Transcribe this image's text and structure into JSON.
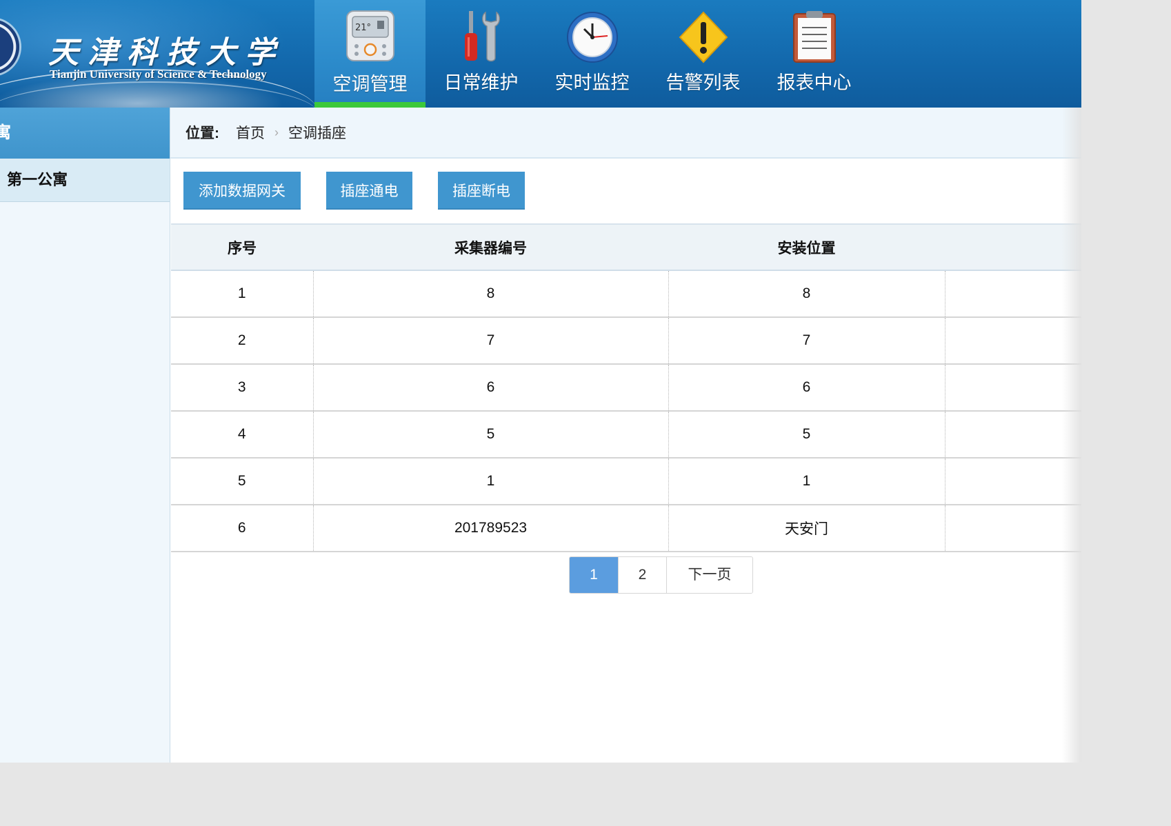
{
  "brand": {
    "name_cn": "天津科技大学",
    "name_en": "Tianjin University of Science & Technology"
  },
  "nav": {
    "items": [
      {
        "label": "空调管理",
        "icon": "air-conditioner-panel-icon",
        "active": true
      },
      {
        "label": "日常维护",
        "icon": "screwdriver-wrench-icon",
        "active": false
      },
      {
        "label": "实时监控",
        "icon": "clock-icon",
        "active": false
      },
      {
        "label": "告警列表",
        "icon": "warning-icon",
        "active": false
      },
      {
        "label": "报表中心",
        "icon": "clipboard-report-icon",
        "active": false
      }
    ],
    "active_indicator_color": "#3cc83a"
  },
  "sidebar": {
    "title": "寓",
    "items": [
      {
        "label": "第一公寓"
      }
    ]
  },
  "breadcrumb": {
    "label": "位置:",
    "items": [
      "首页",
      "空调插座"
    ]
  },
  "toolbar": {
    "add_gateway_label": "添加数据网关",
    "power_on_label": "插座通电",
    "power_off_label": "插座断电"
  },
  "table": {
    "columns": [
      "序号",
      "采集器编号",
      "安装位置",
      ""
    ],
    "rows": [
      [
        "1",
        "8",
        "8",
        ""
      ],
      [
        "2",
        "7",
        "7",
        ""
      ],
      [
        "3",
        "6",
        "6",
        ""
      ],
      [
        "4",
        "5",
        "5",
        ""
      ],
      [
        "5",
        "1",
        "1",
        ""
      ],
      [
        "6",
        "201789523",
        "天安门",
        ""
      ]
    ]
  },
  "pagination": {
    "pages": [
      "1",
      "2"
    ],
    "current": "1",
    "next_label": "下一页"
  },
  "colors": {
    "header": "#1369ad",
    "button": "#4096cf",
    "page_active": "#5b9ddf"
  }
}
